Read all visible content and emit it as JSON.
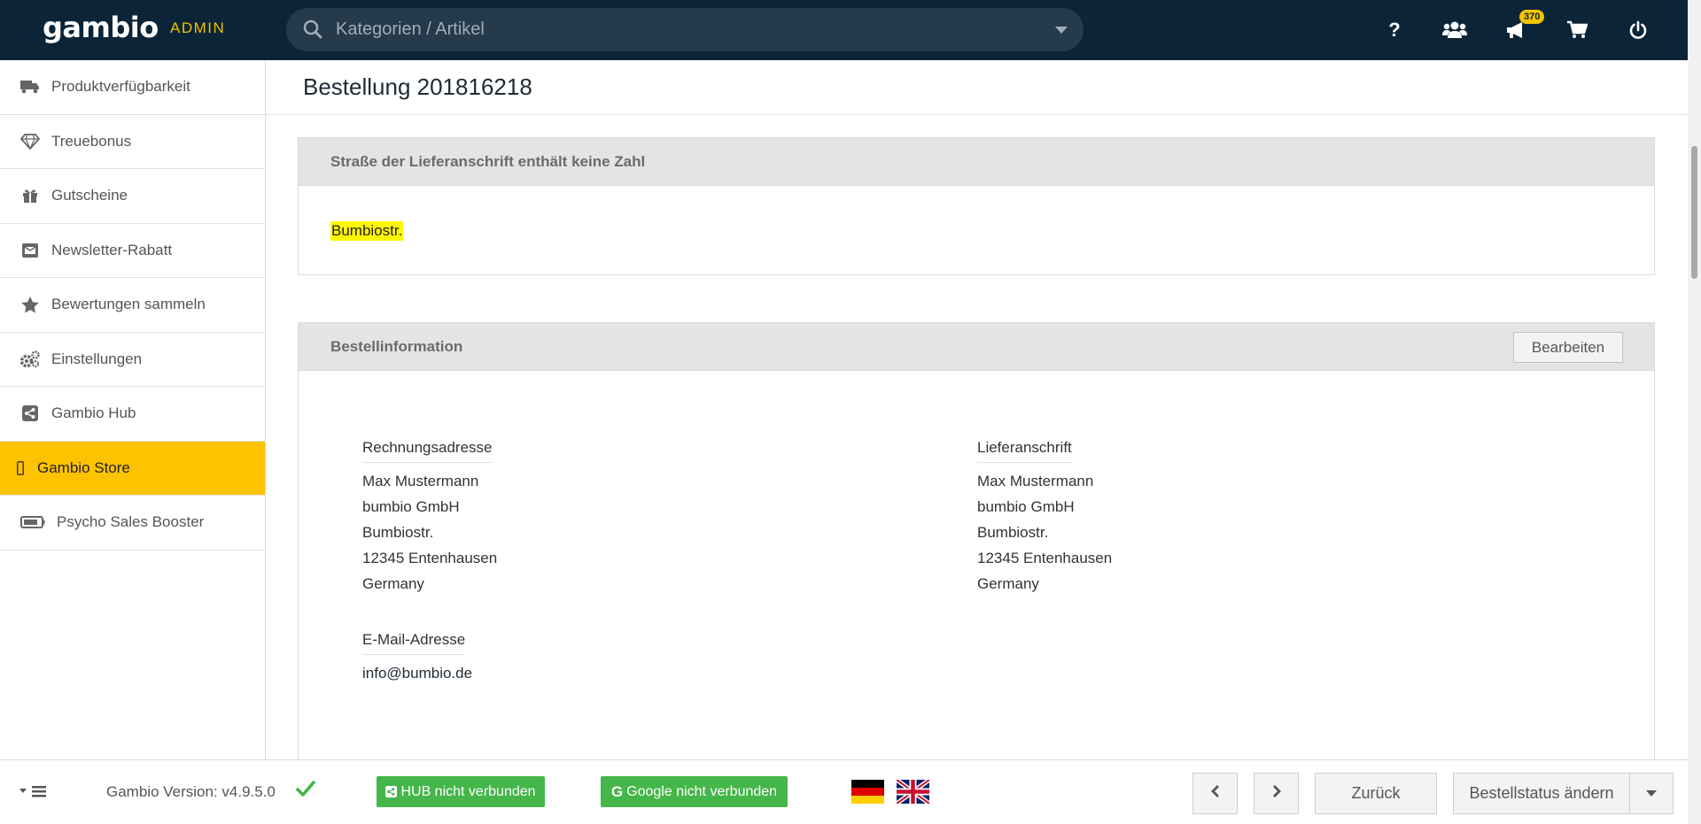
{
  "header": {
    "logo": "gambio",
    "admin_label": "ADMIN",
    "search_placeholder": "Kategorien / Artikel",
    "help_label": "?",
    "notification_count": "370"
  },
  "sidebar": {
    "items": [
      {
        "label": "Produktverfügbarkeit",
        "icon": "truck-icon"
      },
      {
        "label": "Treuebonus",
        "icon": "diamond-icon"
      },
      {
        "label": "Gutscheine",
        "icon": "gift-icon"
      },
      {
        "label": "Newsletter-Rabatt",
        "icon": "envelope-icon"
      },
      {
        "label": "Bewertungen sammeln",
        "icon": "star-icon"
      },
      {
        "label": "Einstellungen",
        "icon": "gears-icon"
      },
      {
        "label": "Gambio Hub",
        "icon": "share-icon"
      },
      {
        "label": "Gambio Store",
        "icon": "phone-icon",
        "active": true
      },
      {
        "label": "Psycho Sales Booster",
        "icon": "battery-icon"
      }
    ]
  },
  "main": {
    "page_title": "Bestellung 201816218",
    "warning_panel": {
      "title": "Straße der Lieferanschrift enthält keine Zahl",
      "highlight": "Bumbiostr."
    },
    "info_panel": {
      "title": "Bestellinformation",
      "edit_label": "Bearbeiten",
      "billing": {
        "label": "Rechnungsadresse",
        "lines": [
          "Max Mustermann",
          "bumbio GmbH",
          "Bumbiostr.",
          "12345 Entenhausen",
          "Germany"
        ]
      },
      "shipping": {
        "label": "Lieferanschrift",
        "lines": [
          "Max Mustermann",
          "bumbio GmbH",
          "Bumbiostr.",
          "12345 Entenhausen",
          "Germany"
        ]
      },
      "email": {
        "label": "E-Mail-Adresse",
        "value": "info@bumbio.de"
      }
    }
  },
  "footer": {
    "version": "Gambio Version: v4.9.5.0",
    "hub_button": "HUB nicht verbunden",
    "google_button": "Google nicht verbunden",
    "back_button": "Zurück",
    "status_button": "Bestellstatus ändern"
  },
  "colors": {
    "topbar": "#0b2437",
    "accent": "#fdc300",
    "green": "#45b649",
    "highlight": "#fff700"
  }
}
